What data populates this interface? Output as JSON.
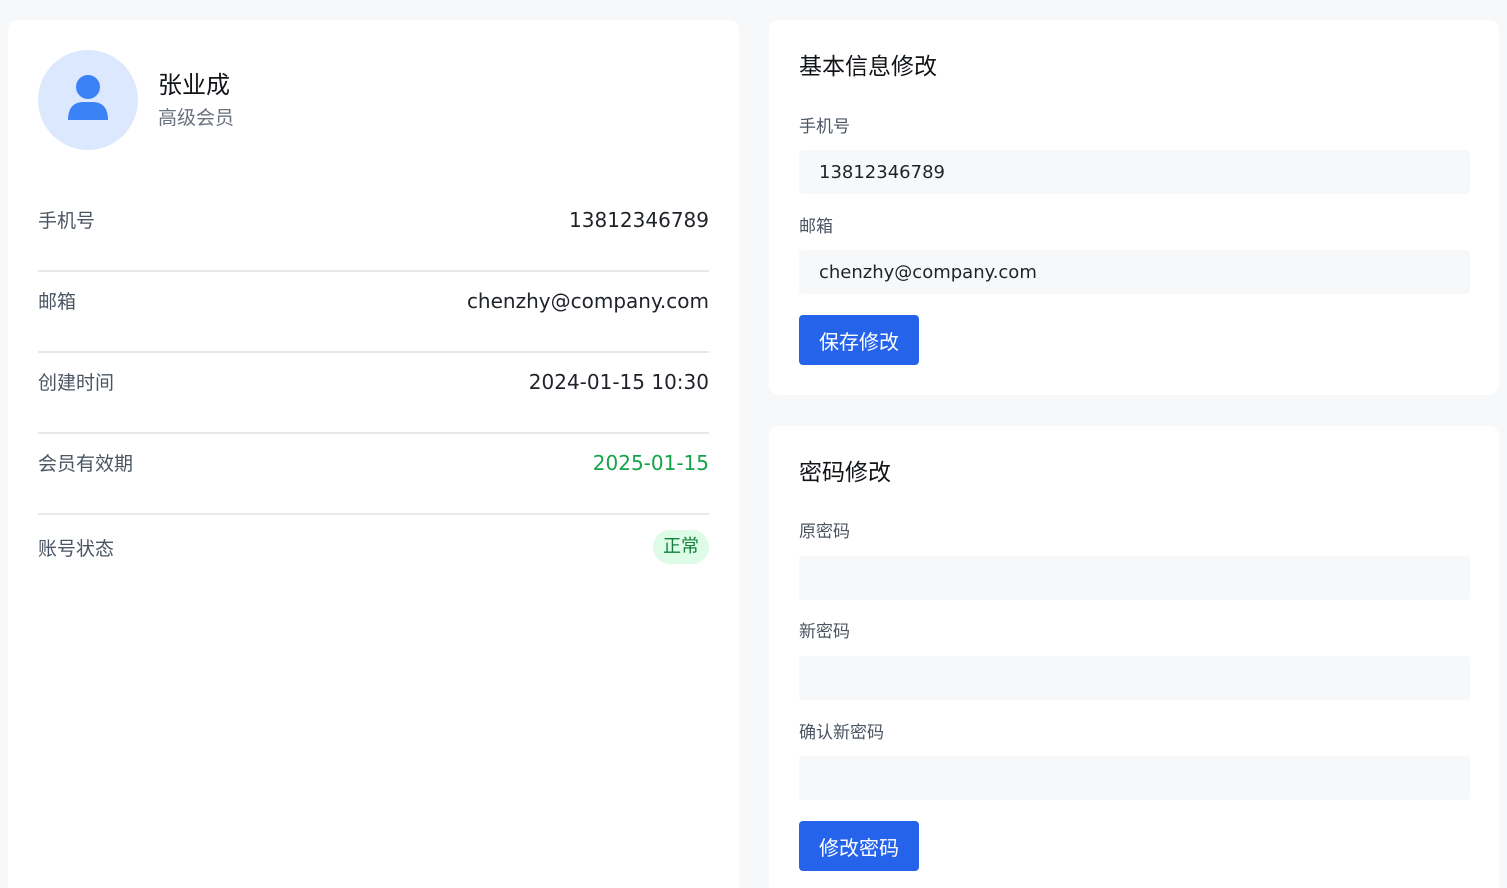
{
  "profile": {
    "name": "张业成",
    "level": "高级会员",
    "avatar_icon": "user-icon",
    "rows": [
      {
        "label": "手机号",
        "value": "13812346789"
      },
      {
        "label": "邮箱",
        "value": "chenzhy@company.com"
      },
      {
        "label": "创建时间",
        "value": "2024-01-15 10:30"
      },
      {
        "label": "会员有效期",
        "value": "2025-01-15"
      },
      {
        "label": "账号状态",
        "value": "正常"
      }
    ]
  },
  "basic_form": {
    "title": "基本信息修改",
    "phone_label": "手机号",
    "phone_value": "13812346789",
    "email_label": "邮箱",
    "email_value": "chenzhy@company.com",
    "save_label": "保存修改"
  },
  "password_form": {
    "title": "密码修改",
    "old_label": "原密码",
    "old_value": "",
    "new_label": "新密码",
    "new_value": "",
    "confirm_label": "确认新密码",
    "confirm_value": "",
    "submit_label": "修改密码"
  },
  "colors": {
    "primary": "#2563eb",
    "avatar_bg": "#dbe8fd",
    "success_text": "#16a34a",
    "badge_bg": "#dcfce7"
  }
}
